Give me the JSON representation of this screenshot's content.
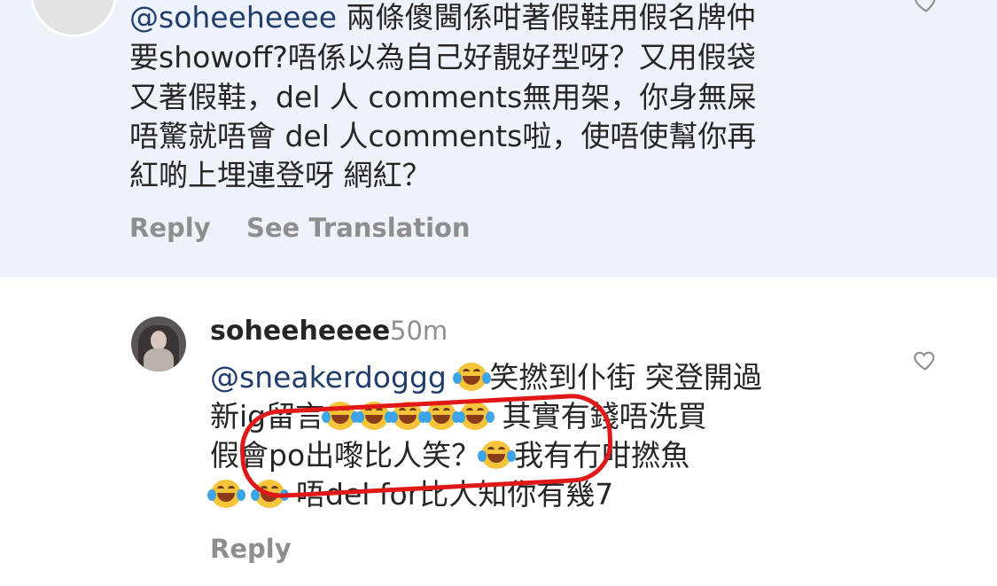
{
  "top_comment": {
    "mention": "@soheeheeee",
    "line1_rest": " 兩條傻閪係咁著假鞋用假名牌仲",
    "line2": "要showoff?唔係以為自己好靚好型呀？又用假袋",
    "line3": "又著假鞋，del 人 comments無用架，你身無屎",
    "line4": "唔驚就唔會 del 人comments啦，使唔使幫你再",
    "line5": "紅啲上埋連登呀 網紅？",
    "reply_label": "Reply",
    "see_translation_label": "See Translation"
  },
  "reply_comment": {
    "username": "soheeheeee",
    "time": "50m",
    "mention": "@sneakerdoggg",
    "line1_rest": "笑撚到仆街 突登開過",
    "line2_a": "新ig留言",
    "line2_b": "其實有錢唔洗買",
    "line3_a": "假會po出嚟比人笑？",
    "line3_b": "我有冇咁撚魚",
    "line4": "唔del for比人知你有幾7",
    "reply_label": "Reply"
  },
  "icons": {
    "heart": "heart-outline-icon",
    "emoji": "face-with-tears-of-joy-icon"
  },
  "colors": {
    "highlight_bg": "#eef2fa",
    "mention": "#203d6b",
    "muted": "#8e8e8e",
    "annotation": "#e11818"
  }
}
